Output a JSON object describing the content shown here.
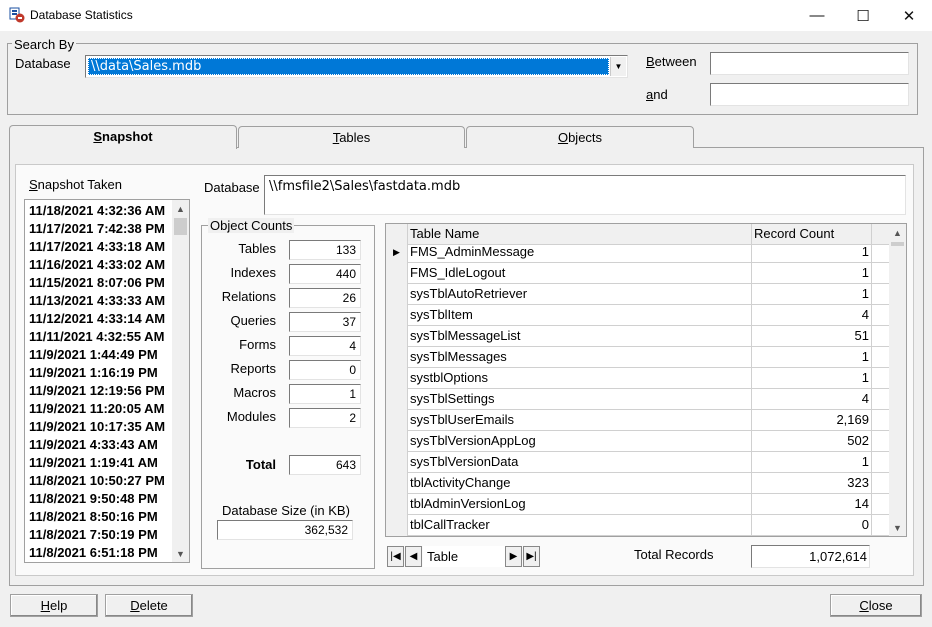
{
  "window": {
    "title": "Database Statistics",
    "minimize_glyph": "—",
    "maximize_glyph": "☐",
    "close_glyph": "✕"
  },
  "search_by": {
    "group_label": "Search By",
    "database_label": "Database",
    "database_value": "\\\\data\\Sales.mdb",
    "between_label": "Between",
    "between_accesskey": "B",
    "between_rest": "etween",
    "and_accesskey": "a",
    "and_rest": "nd",
    "between_value": "",
    "and_value": ""
  },
  "tabs": [
    {
      "key": "S",
      "rest": "napshot"
    },
    {
      "key": "T",
      "rest": "ables"
    },
    {
      "key": "O",
      "rest": "bjects"
    }
  ],
  "snapshot": {
    "label_key": "S",
    "label_rest": "napshot Taken",
    "items": [
      "11/18/2021 4:32:36 AM",
      "11/17/2021 7:42:38 PM",
      "11/17/2021 4:33:18 AM",
      "11/16/2021 4:33:02 AM",
      "11/15/2021 8:07:06 PM",
      "11/13/2021 4:33:33 AM",
      "11/12/2021 4:33:14 AM",
      "11/11/2021 4:32:55 AM",
      "11/9/2021 1:44:49 PM",
      "11/9/2021 1:16:19 PM",
      "11/9/2021 12:19:56 PM",
      "11/9/2021 11:20:05 AM",
      "11/9/2021 10:17:35 AM",
      "11/9/2021 4:33:43 AM",
      "11/9/2021 1:19:41 AM",
      "11/8/2021 10:50:27 PM",
      "11/8/2021 9:50:48 PM",
      "11/8/2021 8:50:16 PM",
      "11/8/2021 7:50:19 PM",
      "11/8/2021 6:51:18 PM"
    ]
  },
  "database_path": {
    "label": "Database",
    "value": "\\\\fmsfile2\\Sales\\fastdata.mdb"
  },
  "object_counts": {
    "group_label": "Object Counts",
    "rows": [
      {
        "label": "Tables",
        "value": "133"
      },
      {
        "label": "Indexes",
        "value": "440"
      },
      {
        "label": "Relations",
        "value": "26"
      },
      {
        "label": "Queries",
        "value": "37"
      },
      {
        "label": "Forms",
        "value": "4"
      },
      {
        "label": "Reports",
        "value": "0"
      },
      {
        "label": "Macros",
        "value": "1"
      },
      {
        "label": "Modules",
        "value": "2"
      }
    ],
    "total_label": "Total",
    "total_value": "643",
    "size_label": "Database Size (in KB)",
    "size_value": "362,532"
  },
  "table_grid": {
    "col_name": "Table Name",
    "col_count": "Record Count",
    "current_row_glyph": "▶",
    "rows": [
      {
        "name": "FMS_AdminMessage",
        "count": "1"
      },
      {
        "name": "FMS_IdleLogout",
        "count": "1"
      },
      {
        "name": "sysTblAutoRetriever",
        "count": "1"
      },
      {
        "name": "sysTblItem",
        "count": "4"
      },
      {
        "name": "sysTblMessageList",
        "count": "51"
      },
      {
        "name": "sysTblMessages",
        "count": "1"
      },
      {
        "name": "systblOptions",
        "count": "1"
      },
      {
        "name": "sysTblSettings",
        "count": "4"
      },
      {
        "name": "sysTblUserEmails",
        "count": "2,169"
      },
      {
        "name": "sysTblVersionAppLog",
        "count": "502"
      },
      {
        "name": "sysTblVersionData",
        "count": "1"
      },
      {
        "name": "tblActivityChange",
        "count": "323"
      },
      {
        "name": "tblAdminVersionLog",
        "count": "14"
      },
      {
        "name": "tblCallTracker",
        "count": "0"
      }
    ]
  },
  "navigator": {
    "first_glyph": "|◀",
    "prev_glyph": "◀",
    "next_glyph": "▶",
    "last_glyph": "▶|",
    "record_label": "Table"
  },
  "totals": {
    "label": "Total Records",
    "value": "1,072,614"
  },
  "buttons": {
    "help_key": "H",
    "help_rest": "elp",
    "delete_key": "D",
    "delete_rest": "elete",
    "close_key": "C",
    "close_rest": "lose"
  }
}
